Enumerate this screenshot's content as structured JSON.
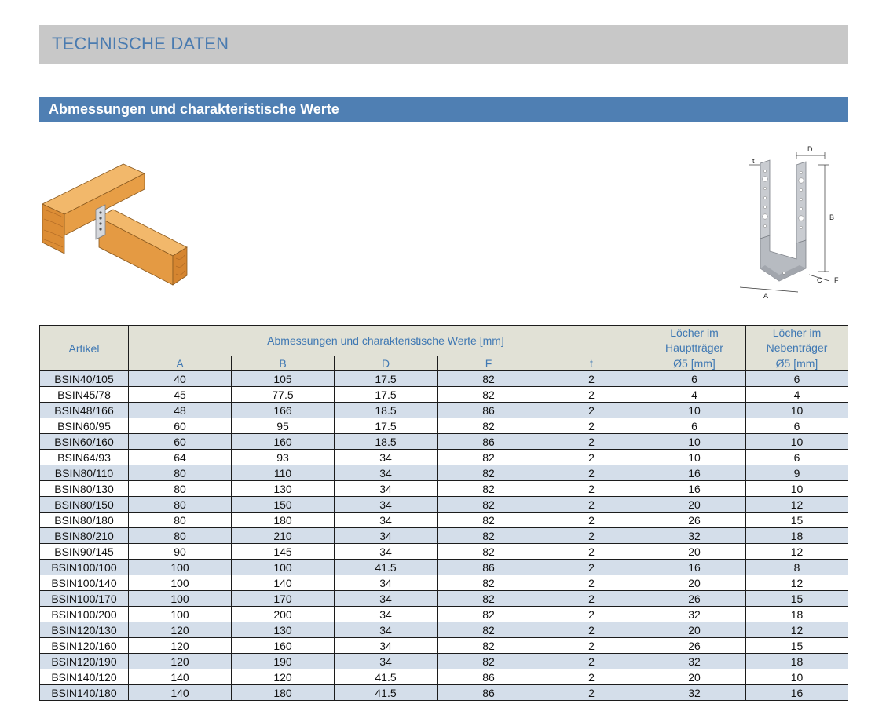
{
  "header": {
    "title": "TECHNISCHE DATEN"
  },
  "section": {
    "title": "Abmessungen und charakteristische Werte"
  },
  "diagram_labels": {
    "t": "t",
    "D": "D",
    "B": "B",
    "A": "A",
    "C": "C",
    "F": "F"
  },
  "table": {
    "col_artikel": "Artikel",
    "group_header": "Abmessungen und charakteristische Werte [mm]",
    "col_haupt": "Löcher im Hauptträger",
    "col_neben": "Löcher im Nebenträger",
    "sub_headers": [
      "A",
      "B",
      "D",
      "F",
      "t",
      "Ø5 [mm]",
      "Ø5 [mm]"
    ],
    "rows": [
      [
        "BSIN40/105",
        "40",
        "105",
        "17.5",
        "82",
        "2",
        "6",
        "6"
      ],
      [
        "BSIN45/78",
        "45",
        "77.5",
        "17.5",
        "82",
        "2",
        "4",
        "4"
      ],
      [
        "BSIN48/166",
        "48",
        "166",
        "18.5",
        "86",
        "2",
        "10",
        "10"
      ],
      [
        "BSIN60/95",
        "60",
        "95",
        "17.5",
        "82",
        "2",
        "6",
        "6"
      ],
      [
        "BSIN60/160",
        "60",
        "160",
        "18.5",
        "86",
        "2",
        "10",
        "10"
      ],
      [
        "BSIN64/93",
        "64",
        "93",
        "34",
        "82",
        "2",
        "10",
        "6"
      ],
      [
        "BSIN80/110",
        "80",
        "110",
        "34",
        "82",
        "2",
        "16",
        "9"
      ],
      [
        "BSIN80/130",
        "80",
        "130",
        "34",
        "82",
        "2",
        "16",
        "10"
      ],
      [
        "BSIN80/150",
        "80",
        "150",
        "34",
        "82",
        "2",
        "20",
        "12"
      ],
      [
        "BSIN80/180",
        "80",
        "180",
        "34",
        "82",
        "2",
        "26",
        "15"
      ],
      [
        "BSIN80/210",
        "80",
        "210",
        "34",
        "82",
        "2",
        "32",
        "18"
      ],
      [
        "BSIN90/145",
        "90",
        "145",
        "34",
        "82",
        "2",
        "20",
        "12"
      ],
      [
        "BSIN100/100",
        "100",
        "100",
        "41.5",
        "86",
        "2",
        "16",
        "8"
      ],
      [
        "BSIN100/140",
        "100",
        "140",
        "34",
        "82",
        "2",
        "20",
        "12"
      ],
      [
        "BSIN100/170",
        "100",
        "170",
        "34",
        "82",
        "2",
        "26",
        "15"
      ],
      [
        "BSIN100/200",
        "100",
        "200",
        "34",
        "82",
        "2",
        "32",
        "18"
      ],
      [
        "BSIN120/130",
        "120",
        "130",
        "34",
        "82",
        "2",
        "20",
        "12"
      ],
      [
        "BSIN120/160",
        "120",
        "160",
        "34",
        "82",
        "2",
        "26",
        "15"
      ],
      [
        "BSIN120/190",
        "120",
        "190",
        "34",
        "82",
        "2",
        "32",
        "18"
      ],
      [
        "BSIN140/120",
        "140",
        "120",
        "41.5",
        "86",
        "2",
        "20",
        "10"
      ],
      [
        "BSIN140/180",
        "140",
        "180",
        "41.5",
        "86",
        "2",
        "32",
        "16"
      ]
    ]
  },
  "colors": {
    "header_bar": "#c8c8c8",
    "header_text": "#4a7bb0",
    "section_bar": "#4f7fb3",
    "table_header_bg": "#e1e1d6",
    "table_header_text": "#3f78b3",
    "row_stripe": "#d4deea"
  }
}
